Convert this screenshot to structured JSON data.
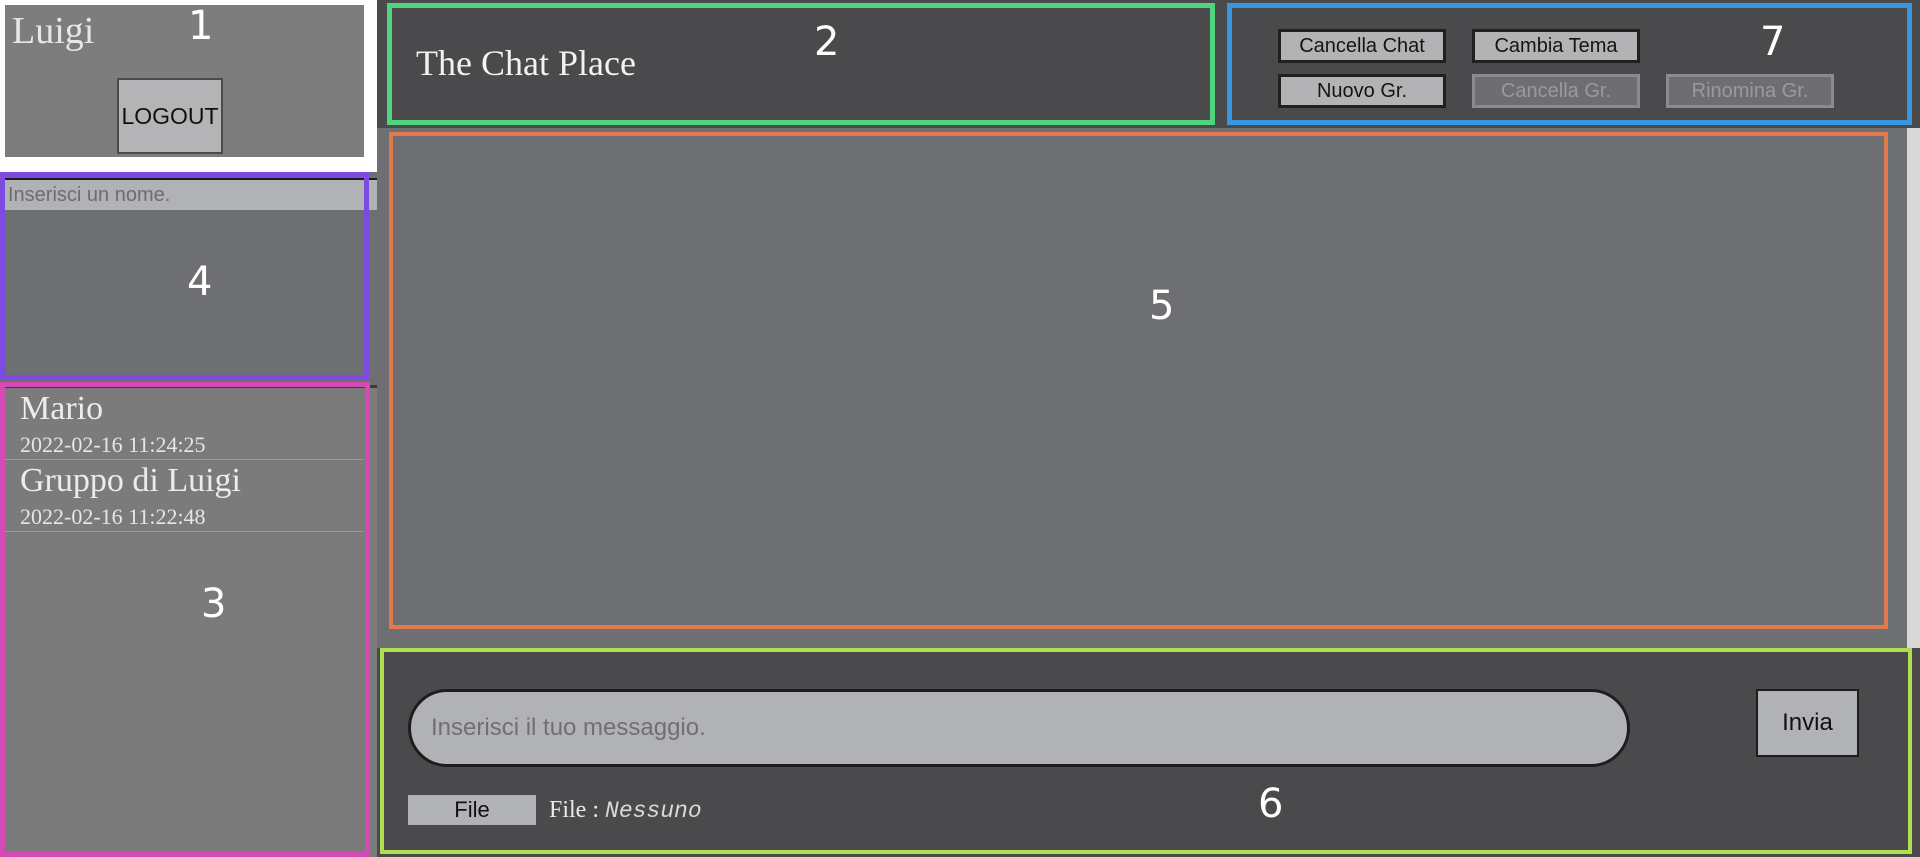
{
  "user_panel": {
    "username": "Luigi",
    "logout_label": "LOGOUT"
  },
  "search": {
    "placeholder": "Inserisci un nome."
  },
  "chat_list": {
    "items": [
      {
        "name": "Mario",
        "timestamp": "2022-02-16 11:24:25"
      },
      {
        "name": "Gruppo di Luigi",
        "timestamp": "2022-02-16 11:22:48"
      }
    ]
  },
  "header": {
    "title": "The Chat Place"
  },
  "toolbar": {
    "clear_chat_label": "Cancella Chat",
    "change_theme_label": "Cambia Tema",
    "new_group_label": "Nuovo Gr.",
    "delete_group_label": "Cancella Gr.",
    "rename_group_label": "Rinomina Gr.",
    "delete_group_enabled": false,
    "rename_group_enabled": false
  },
  "composer": {
    "message_placeholder": "Inserisci il tuo messaggio.",
    "send_label": "Invia",
    "file_button_label": "File",
    "file_label": "File :",
    "file_value": "Nessuno"
  },
  "region_labels": [
    "1",
    "2",
    "3",
    "4",
    "5",
    "6",
    "7"
  ],
  "colors": {
    "region_1": "#ffffff",
    "region_2": "#4fd37d",
    "region_3": "#d44bb5",
    "region_4": "#7d4be0",
    "region_5": "#e07a4a",
    "region_6": "#b0de4d",
    "region_7": "#3b96e0"
  }
}
